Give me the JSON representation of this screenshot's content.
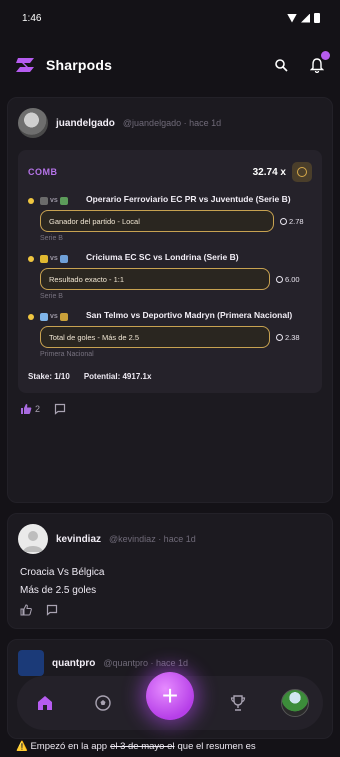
{
  "status_bar": {
    "time": "1:46"
  },
  "header": {
    "app_title": "Sharpods",
    "icons": [
      "search-icon",
      "bell-icon"
    ],
    "colors": {
      "brand": "#B65CF0",
      "background": "#141217"
    }
  },
  "posts": [
    {
      "username": "juandelgado",
      "handle": "@juandelgado · hace 1d",
      "bet": {
        "type": "COMB",
        "odds": "32.74 x",
        "legs": [
          {
            "match": "Operario Ferroviario EC PR vs Juventude (Serie B)",
            "pick": "Ganador del partido - Local",
            "odds": "2.78",
            "league": "Serie B"
          },
          {
            "match": "Criciuma EC SC vs Londrina (Serie B)",
            "pick": "Resultado exacto - 1:1",
            "odds": "6.00",
            "league": "Serie B"
          },
          {
            "match": "San Telmo vs Deportivo Madryn (Primera Nacional)",
            "pick": "Total de goles - Más de 2.5",
            "odds": "2.38",
            "league": "Primera Nacional"
          }
        ],
        "stake": "Stake: 1/10",
        "potential": "Potential: 4917.1x"
      },
      "likes": "2"
    },
    {
      "username": "kevindiaz",
      "handle": "@kevindiaz · hace 1d",
      "text_lines": [
        "Croacia Vs Bélgica",
        "Más de 2.5 goles"
      ]
    },
    {
      "username": "quantpro",
      "handle": "@quantpro · hace 1d"
    }
  ],
  "bottom_nav": {
    "fab_label": "+"
  },
  "banner": {
    "text_start": "⚠️ Empezó en la app",
    "text_struck": "el 3 de mayo el",
    "text_end": "que el resumen es"
  }
}
